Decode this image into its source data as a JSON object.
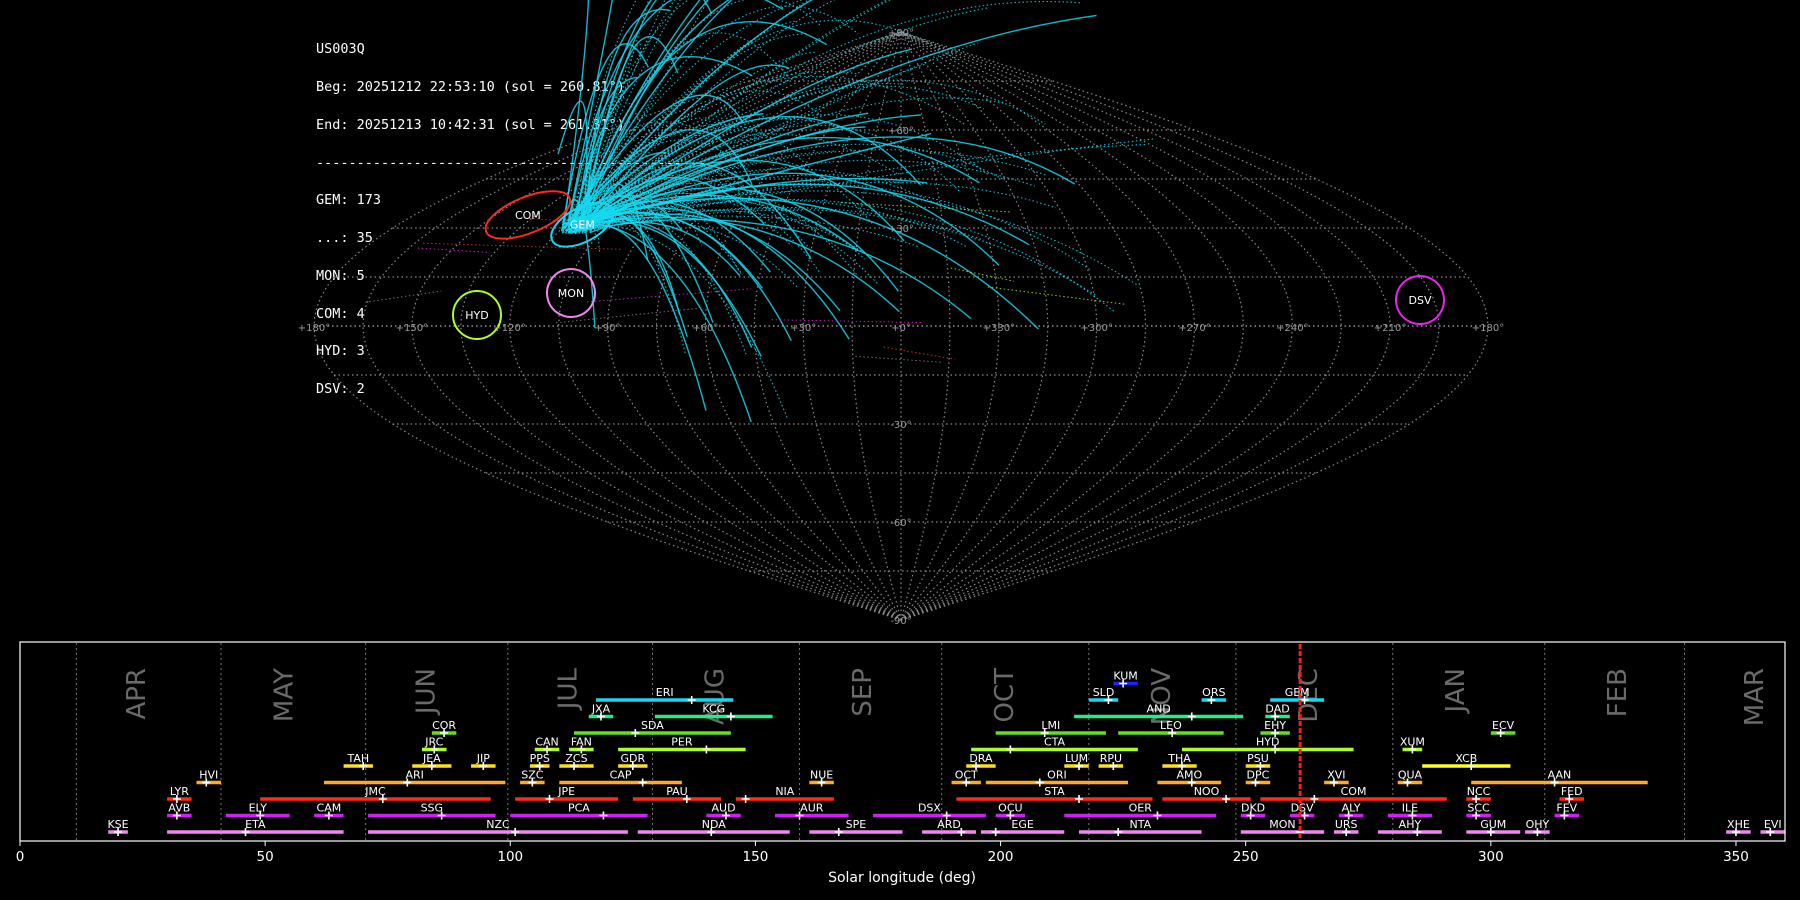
{
  "info": {
    "station": "US003Q",
    "begin": "Beg: 20251212 22:53:10 (sol = 260.81°)",
    "end": "End: 20251213 10:42:31 (sol = 261.31°)",
    "separator": "------------------------------------------------",
    "counts": [
      "GEM: 173",
      "...: 35",
      "MON: 5",
      "COM: 4",
      "HYD: 3",
      "DSV: 2"
    ]
  },
  "sky_map": {
    "projection": "sinusoidal",
    "grid": true,
    "lon_tick_labels": [
      "+180°",
      "+150°",
      "+120°",
      "+90°",
      "+60°",
      "+30°",
      "+0°",
      "+330°",
      "+300°",
      "+270°",
      "+240°",
      "+210°",
      "+180°"
    ],
    "lat_tick_labels": [
      "+90°",
      "+60°",
      "+30°",
      "-30°",
      "-60°",
      "-90°"
    ],
    "radiants": [
      {
        "code": "COM",
        "color": "#ff2a1a"
      },
      {
        "code": "GEM",
        "color": "#18d8f0"
      },
      {
        "code": "MON",
        "color": "#ee88ee"
      },
      {
        "code": "HYD",
        "color": "#aaff2a"
      },
      {
        "code": "DSV",
        "color": "#ee22ee"
      }
    ]
  },
  "chart_data": {
    "type": "timeline",
    "xlabel": "Solar longitude (deg)",
    "xlim": [
      0,
      360
    ],
    "x_ticks": [
      0,
      50,
      100,
      150,
      200,
      250,
      300,
      350
    ],
    "grid": true,
    "current_sol": 261.1,
    "months": [
      {
        "label": "APR",
        "start": 11.5,
        "center": 24
      },
      {
        "label": "MAY",
        "start": 41,
        "center": 54
      },
      {
        "label": "JUN",
        "start": 70.5,
        "center": 83
      },
      {
        "label": "JUL",
        "start": 99.5,
        "center": 112
      },
      {
        "label": "AUG",
        "start": 129,
        "center": 142
      },
      {
        "label": "SEP",
        "start": 159,
        "center": 172
      },
      {
        "label": "OCT",
        "start": 188,
        "center": 201
      },
      {
        "label": "NOV",
        "start": 218,
        "center": 233
      },
      {
        "label": "DEC",
        "start": 248,
        "center": 263
      },
      {
        "label": "JAN",
        "start": 280,
        "center": 293
      },
      {
        "label": "FEB",
        "start": 311,
        "center": 326
      },
      {
        "label": "MAR",
        "start": 339.5,
        "center": 354
      }
    ],
    "showers": [
      {
        "code": "KUM",
        "start": 223,
        "end": 228,
        "peak": 225,
        "row": 9,
        "color": "#2222ff"
      },
      {
        "code": "ERI",
        "start": 117.5,
        "end": 145.5,
        "peak": 137,
        "row": 8,
        "color": "#18d8f0"
      },
      {
        "code": "SLD",
        "start": 218,
        "end": 224,
        "peak": 222,
        "row": 8,
        "color": "#18d8f0"
      },
      {
        "code": "ORS",
        "start": 241,
        "end": 246,
        "peak": 243,
        "row": 8,
        "color": "#18d8f0"
      },
      {
        "code": "GEM",
        "start": 255,
        "end": 266,
        "peak": 262,
        "row": 8,
        "color": "#18d8f0"
      },
      {
        "code": "JXA",
        "start": 116,
        "end": 121,
        "peak": 118.5,
        "row": 7,
        "color": "#22ee88"
      },
      {
        "code": "KCG",
        "start": 129.5,
        "end": 153.5,
        "peak": 145,
        "row": 7,
        "color": "#22ee88"
      },
      {
        "code": "AND",
        "start": 215,
        "end": 249.5,
        "peak": 239,
        "row": 7,
        "color": "#22ee88"
      },
      {
        "code": "DAD",
        "start": 254,
        "end": 259,
        "peak": 256,
        "row": 7,
        "color": "#22ee88"
      },
      {
        "code": "COR",
        "start": 84,
        "end": 89,
        "peak": 86.5,
        "row": 6,
        "color": "#66dd22"
      },
      {
        "code": "SDA",
        "start": 113,
        "end": 145,
        "peak": 125.5,
        "row": 6,
        "color": "#66dd22"
      },
      {
        "code": "LMI",
        "start": 199,
        "end": 221.5,
        "peak": 209,
        "row": 6,
        "color": "#66dd22"
      },
      {
        "code": "LEO",
        "start": 224,
        "end": 245.5,
        "peak": 235,
        "row": 6,
        "color": "#66dd22"
      },
      {
        "code": "EHY",
        "start": 253,
        "end": 259,
        "peak": 256,
        "row": 6,
        "color": "#66dd22"
      },
      {
        "code": "ECV",
        "start": 300,
        "end": 305,
        "peak": 302,
        "row": 6,
        "color": "#66dd22"
      },
      {
        "code": "JRC",
        "start": 82,
        "end": 87,
        "peak": 84.5,
        "row": 5,
        "color": "#aaff2a"
      },
      {
        "code": "CAN",
        "start": 105,
        "end": 110,
        "peak": 107.5,
        "row": 5,
        "color": "#aaff2a"
      },
      {
        "code": "FAN",
        "start": 112,
        "end": 117,
        "peak": 114.5,
        "row": 5,
        "color": "#aaff2a"
      },
      {
        "code": "PER",
        "start": 122,
        "end": 148,
        "peak": 140,
        "row": 5,
        "color": "#aaff2a"
      },
      {
        "code": "CTA",
        "start": 194,
        "end": 228,
        "peak": 202,
        "row": 5,
        "color": "#aaff2a"
      },
      {
        "code": "HYD",
        "start": 237,
        "end": 272,
        "peak": 256,
        "row": 5,
        "color": "#aaff2a"
      },
      {
        "code": "XUM",
        "start": 282,
        "end": 286,
        "peak": 284,
        "row": 5,
        "color": "#aaff2a"
      },
      {
        "code": "TAH",
        "start": 66,
        "end": 72,
        "peak": 70,
        "row": 4,
        "color": "#ffdd22"
      },
      {
        "code": "JEA",
        "start": 80,
        "end": 88,
        "peak": 84,
        "row": 4,
        "color": "#ffdd22"
      },
      {
        "code": "JIP",
        "start": 92,
        "end": 97,
        "peak": 94.5,
        "row": 4,
        "color": "#ffdd22"
      },
      {
        "code": "PPS",
        "start": 104,
        "end": 108,
        "peak": 106,
        "row": 4,
        "color": "#ffdd22"
      },
      {
        "code": "ZCS",
        "start": 110,
        "end": 117,
        "peak": 113,
        "row": 4,
        "color": "#ffdd22"
      },
      {
        "code": "GDR",
        "start": 122,
        "end": 128,
        "peak": 125,
        "row": 4,
        "color": "#ffdd22"
      },
      {
        "code": "DRA",
        "start": 193,
        "end": 199,
        "peak": 195,
        "row": 4,
        "color": "#ffdd22"
      },
      {
        "code": "LUM",
        "start": 213,
        "end": 218,
        "peak": 216,
        "row": 4,
        "color": "#ffdd22"
      },
      {
        "code": "RPU",
        "start": 220,
        "end": 225,
        "peak": 223,
        "row": 4,
        "color": "#ffdd22"
      },
      {
        "code": "THA",
        "start": 233,
        "end": 240,
        "peak": 237,
        "row": 4,
        "color": "#ffdd22"
      },
      {
        "code": "PSU",
        "start": 250,
        "end": 255,
        "peak": 253,
        "row": 4,
        "color": "#ffdd22"
      },
      {
        "code": "XCB",
        "start": 286,
        "end": 304,
        "peak": 296,
        "row": 4,
        "color": "#ffff22"
      },
      {
        "code": "HVI",
        "start": 36,
        "end": 41,
        "peak": 38,
        "row": 3,
        "color": "#ffaa22"
      },
      {
        "code": "ARI",
        "start": 62,
        "end": 99,
        "peak": 79,
        "row": 3,
        "color": "#ffaa22"
      },
      {
        "code": "SZC",
        "start": 102,
        "end": 107,
        "peak": 104.5,
        "row": 3,
        "color": "#ffaa22"
      },
      {
        "code": "CAP",
        "start": 110,
        "end": 135,
        "peak": 127,
        "row": 3,
        "color": "#ffaa22"
      },
      {
        "code": "NUE",
        "start": 161,
        "end": 166,
        "peak": 163.5,
        "row": 3,
        "color": "#ffaa22"
      },
      {
        "code": "OCT",
        "start": 190,
        "end": 196,
        "peak": 193,
        "row": 3,
        "color": "#ffaa22"
      },
      {
        "code": "ORI",
        "start": 197,
        "end": 226,
        "peak": 208,
        "row": 3,
        "color": "#ffaa22"
      },
      {
        "code": "AMO",
        "start": 232,
        "end": 245,
        "peak": 239,
        "row": 3,
        "color": "#ffaa22"
      },
      {
        "code": "DPC",
        "start": 250,
        "end": 255,
        "peak": 252,
        "row": 3,
        "color": "#ffaa22"
      },
      {
        "code": "XVI",
        "start": 266,
        "end": 271,
        "peak": 268,
        "row": 3,
        "color": "#ffaa22"
      },
      {
        "code": "QUA",
        "start": 281,
        "end": 286,
        "peak": 283,
        "row": 3,
        "color": "#ffaa22"
      },
      {
        "code": "AAN",
        "start": 296,
        "end": 332,
        "peak": 313,
        "row": 3,
        "color": "#ffaa22"
      },
      {
        "code": "LYR",
        "start": 30,
        "end": 35,
        "peak": 32,
        "row": 2,
        "color": "#ff2a1a"
      },
      {
        "code": "JMC",
        "start": 49,
        "end": 96,
        "peak": 74,
        "row": 2,
        "color": "#ff2a1a"
      },
      {
        "code": "JPE",
        "start": 101,
        "end": 122,
        "peak": 108,
        "row": 2,
        "color": "#ff2a1a"
      },
      {
        "code": "PAU",
        "start": 125,
        "end": 143,
        "peak": 136,
        "row": 2,
        "color": "#ff2a1a"
      },
      {
        "code": "NIA",
        "start": 146,
        "end": 166,
        "peak": 148,
        "row": 2,
        "color": "#ff2a1a"
      },
      {
        "code": "STA",
        "start": 191,
        "end": 231,
        "peak": 216,
        "row": 2,
        "color": "#ff2a1a"
      },
      {
        "code": "NOO",
        "start": 233,
        "end": 251,
        "peak": 246,
        "row": 2,
        "color": "#ff2a1a"
      },
      {
        "code": "COM",
        "start": 253,
        "end": 291,
        "peak": 264,
        "row": 2,
        "color": "#ff2a1a"
      },
      {
        "code": "NCC",
        "start": 295,
        "end": 300,
        "peak": 297,
        "row": 2,
        "color": "#ff2a1a"
      },
      {
        "code": "FED",
        "start": 314,
        "end": 319,
        "peak": 316,
        "row": 2,
        "color": "#ff2a1a"
      },
      {
        "code": "AVB",
        "start": 30,
        "end": 35,
        "peak": 32,
        "row": 1,
        "color": "#cc22ee"
      },
      {
        "code": "ELY",
        "start": 42,
        "end": 55,
        "peak": 49,
        "row": 1,
        "color": "#cc22ee"
      },
      {
        "code": "CAM",
        "start": 60,
        "end": 66,
        "peak": 63,
        "row": 1,
        "color": "#cc22ee"
      },
      {
        "code": "SSG",
        "start": 71,
        "end": 97,
        "peak": 86,
        "row": 1,
        "color": "#cc22ee"
      },
      {
        "code": "PCA",
        "start": 100,
        "end": 128,
        "peak": 119,
        "row": 1,
        "color": "#cc22ee"
      },
      {
        "code": "AUD",
        "start": 140,
        "end": 147,
        "peak": 144,
        "row": 1,
        "color": "#cc22ee"
      },
      {
        "code": "AUR",
        "start": 154,
        "end": 169,
        "peak": 159,
        "row": 1,
        "color": "#cc22ee"
      },
      {
        "code": "DSX",
        "start": 174,
        "end": 197,
        "peak": 189,
        "row": 1,
        "color": "#cc22ee"
      },
      {
        "code": "OCU",
        "start": 199,
        "end": 205,
        "peak": 202,
        "row": 1,
        "color": "#cc22ee"
      },
      {
        "code": "OER",
        "start": 213,
        "end": 244,
        "peak": 232,
        "row": 1,
        "color": "#cc22ee"
      },
      {
        "code": "DKD",
        "start": 249,
        "end": 254,
        "peak": 251,
        "row": 1,
        "color": "#cc22ee"
      },
      {
        "code": "DSV",
        "start": 259,
        "end": 264,
        "peak": 262,
        "row": 1,
        "color": "#cc22ee"
      },
      {
        "code": "ALY",
        "start": 269,
        "end": 274,
        "peak": 271,
        "row": 1,
        "color": "#cc22ee"
      },
      {
        "code": "ILE",
        "start": 279,
        "end": 288,
        "peak": 284,
        "row": 1,
        "color": "#cc22ee"
      },
      {
        "code": "SCC",
        "start": 295,
        "end": 300,
        "peak": 297,
        "row": 1,
        "color": "#cc22ee"
      },
      {
        "code": "FEV",
        "start": 313,
        "end": 318,
        "peak": 315,
        "row": 1,
        "color": "#cc22ee"
      },
      {
        "code": "KSE",
        "start": 18,
        "end": 22,
        "peak": 20,
        "row": 0,
        "color": "#ee88ee"
      },
      {
        "code": "ETA",
        "start": 30,
        "end": 66,
        "peak": 46,
        "row": 0,
        "color": "#ee88ee"
      },
      {
        "code": "NZC",
        "start": 71,
        "end": 124,
        "peak": 101,
        "row": 0,
        "color": "#ee88ee"
      },
      {
        "code": "NDA",
        "start": 126,
        "end": 157,
        "peak": 141,
        "row": 0,
        "color": "#ee88ee"
      },
      {
        "code": "SPE",
        "start": 161,
        "end": 180,
        "peak": 167,
        "row": 0,
        "color": "#ee88ee"
      },
      {
        "code": "ARD",
        "start": 184,
        "end": 195,
        "peak": 192,
        "row": 0,
        "color": "#ee88ee"
      },
      {
        "code": "EGE",
        "start": 196,
        "end": 213,
        "peak": 199,
        "row": 0,
        "color": "#ee88ee"
      },
      {
        "code": "NTA",
        "start": 216,
        "end": 241,
        "peak": 224,
        "row": 0,
        "color": "#ee88ee"
      },
      {
        "code": "MON",
        "start": 249,
        "end": 266,
        "peak": 261,
        "row": 0,
        "color": "#ee88ee"
      },
      {
        "code": "URS",
        "start": 268,
        "end": 273,
        "peak": 270.5,
        "row": 0,
        "color": "#ee88ee"
      },
      {
        "code": "AHY",
        "start": 277,
        "end": 290,
        "peak": 285,
        "row": 0,
        "color": "#ee88ee"
      },
      {
        "code": "GUM",
        "start": 295,
        "end": 306,
        "peak": 300,
        "row": 0,
        "color": "#ee88ee"
      },
      {
        "code": "OHY",
        "start": 307,
        "end": 312,
        "peak": 309.5,
        "row": 0,
        "color": "#ee88ee"
      },
      {
        "code": "XHE",
        "start": 348,
        "end": 353,
        "peak": 350,
        "row": 0,
        "color": "#ee88ee"
      },
      {
        "code": "EVI",
        "start": 355,
        "end": 360,
        "peak": 357,
        "row": 0,
        "color": "#ee88ee"
      }
    ]
  }
}
